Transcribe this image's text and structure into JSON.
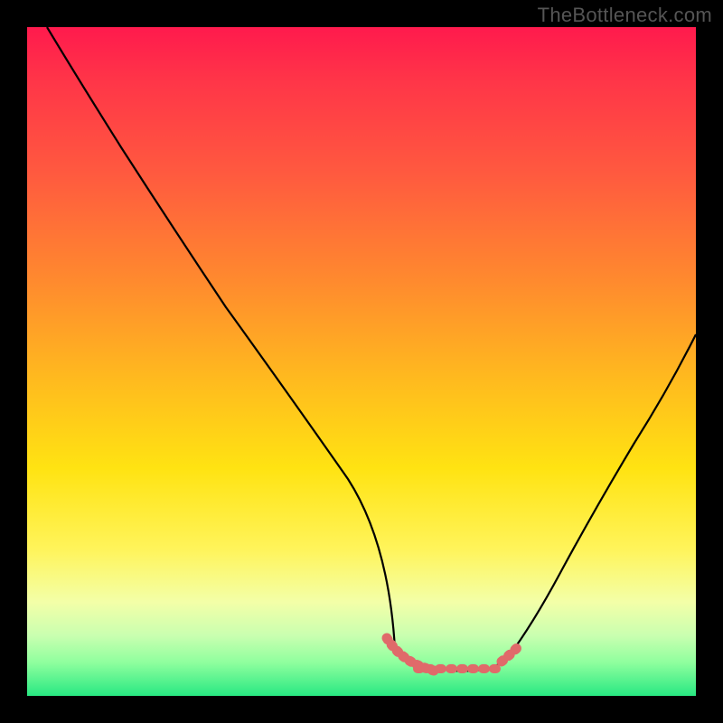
{
  "watermark": "TheBottleneck.com",
  "chart_data": {
    "type": "line",
    "title": "",
    "xlabel": "",
    "ylabel": "",
    "xlim": [
      0,
      100
    ],
    "ylim": [
      0,
      100
    ],
    "series": [
      {
        "name": "curve-left",
        "x": [
          3,
          8,
          14,
          20,
          26,
          32,
          38,
          44,
          50,
          55
        ],
        "values": [
          100,
          92,
          82,
          72,
          62,
          52,
          42,
          32,
          20,
          7
        ]
      },
      {
        "name": "curve-right",
        "x": [
          72,
          76,
          80,
          84,
          88,
          92,
          96,
          100
        ],
        "values": [
          6,
          12,
          19,
          27,
          36,
          45,
          52,
          58
        ]
      },
      {
        "name": "flat-bottom",
        "x": [
          55,
          58,
          61,
          64,
          67,
          70,
          72
        ],
        "values": [
          7,
          5,
          4,
          3.5,
          3.5,
          4,
          6
        ]
      }
    ],
    "annotations": [
      {
        "name": "highlight-left",
        "x_range": [
          54,
          60
        ],
        "y": 6
      },
      {
        "name": "highlight-mid",
        "x_range": [
          58,
          71
        ],
        "y": 4
      },
      {
        "name": "highlight-right",
        "x_range": [
          71,
          74
        ],
        "y": 7
      }
    ],
    "colors": {
      "curve": "#000000",
      "highlight": "#e06a6a",
      "gradient_stops": [
        "#ff1a4d",
        "#ff5a3f",
        "#ff8a2e",
        "#ffb81f",
        "#ffe312",
        "#fff45a",
        "#c9ffb0",
        "#28e882"
      ]
    }
  }
}
